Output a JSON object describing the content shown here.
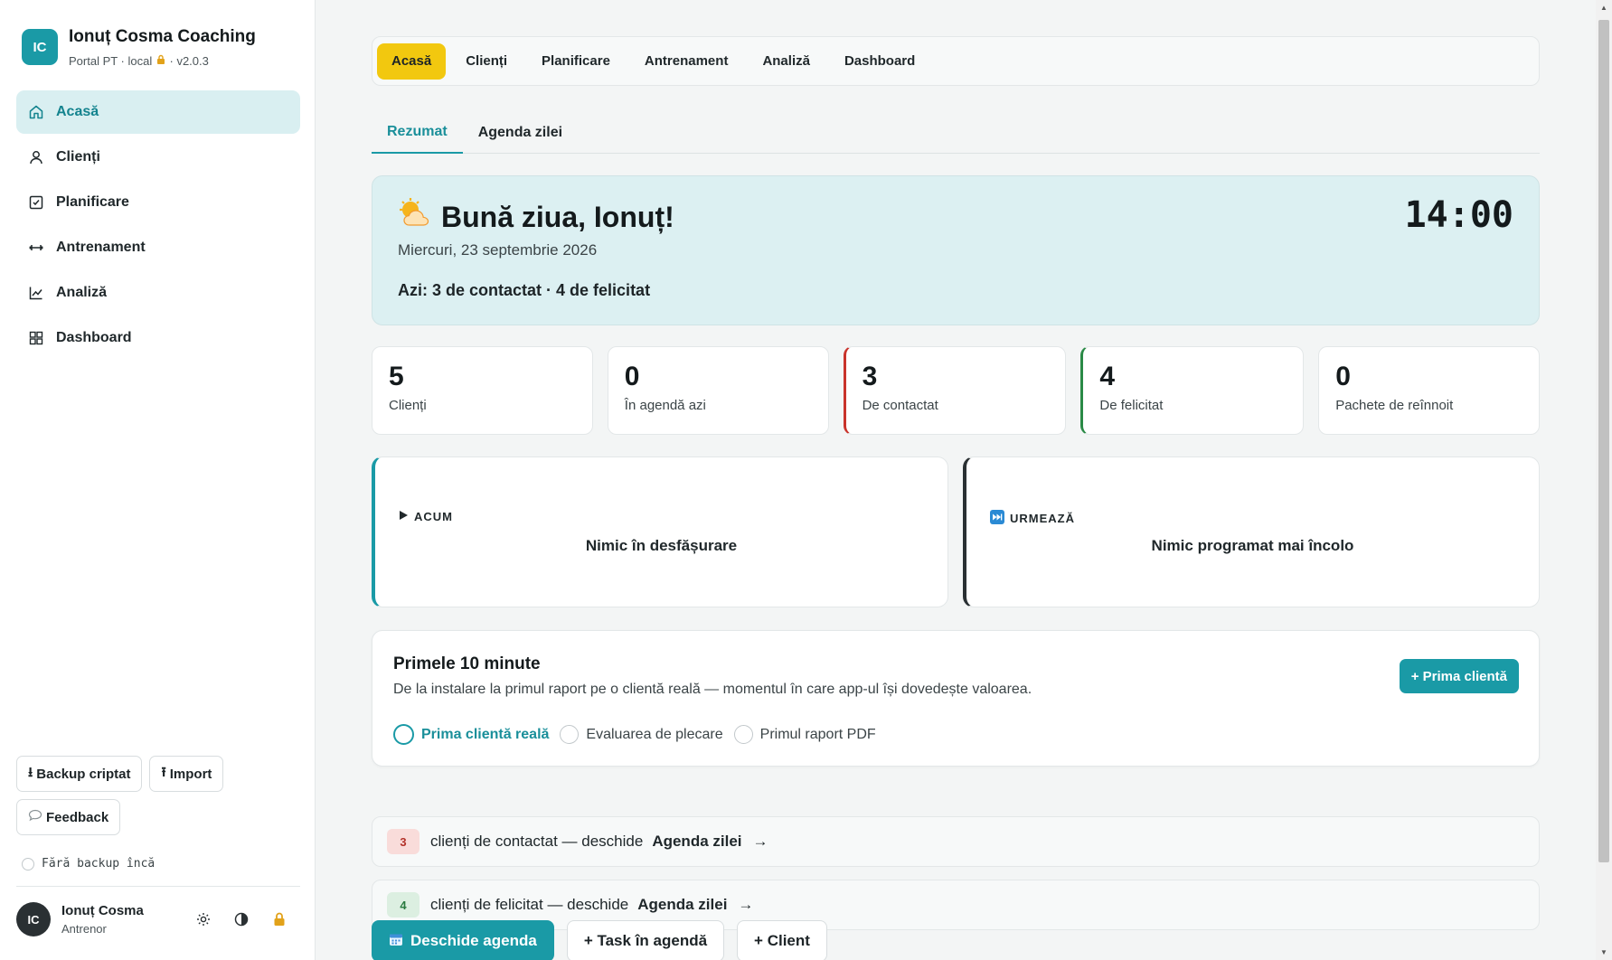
{
  "brand": {
    "initials": "IC",
    "title": "Ionuț Cosma Coaching",
    "subtitle_pre": "Portal PT · local",
    "subtitle_post": "· v2.0.3"
  },
  "sidebar": {
    "items": [
      {
        "label": "Acasă",
        "icon": "home-icon"
      },
      {
        "label": "Clienți",
        "icon": "user-icon"
      },
      {
        "label": "Planificare",
        "icon": "checklist-icon"
      },
      {
        "label": "Antrenament",
        "icon": "dumbbell-icon"
      },
      {
        "label": "Analiză",
        "icon": "chart-line-icon"
      },
      {
        "label": "Dashboard",
        "icon": "grid-icon"
      }
    ],
    "backup_label": "Backup criptat",
    "import_label": "Import",
    "feedback_label": "Feedback",
    "backup_status": "Fără backup încă"
  },
  "user": {
    "initials": "IC",
    "name": "Ionuț Cosma",
    "role": "Antrenor"
  },
  "topnav": [
    "Acasă",
    "Clienți",
    "Planificare",
    "Antrenament",
    "Analiză",
    "Dashboard"
  ],
  "subtabs": [
    "Rezumat",
    "Agenda zilei"
  ],
  "hero": {
    "greeting": "Bună ziua, Ionuț!",
    "date": "Miercuri, 23 septembrie 2026",
    "summary": "Azi: 3 de contactat · 4 de felicitat",
    "time": "14:00"
  },
  "stats": [
    {
      "value": "5",
      "label": "Clienți"
    },
    {
      "value": "0",
      "label": "În agendă azi"
    },
    {
      "value": "3",
      "label": "De contactat"
    },
    {
      "value": "4",
      "label": "De felicitat"
    },
    {
      "value": "0",
      "label": "Pachete de reînnoit"
    }
  ],
  "now_panel": {
    "label": "ACUM",
    "text": "Nimic în desfășurare"
  },
  "next_panel": {
    "label": "URMEAZĂ",
    "text": "Nimic programat mai încolo"
  },
  "onboarding": {
    "title": "Primele 10 minute",
    "description": "De la instalare la primul raport pe o clientă reală — momentul în care app-ul își dovedește valoarea.",
    "button": "+ Prima clientă",
    "steps": [
      "Prima clientă reală",
      "Evaluarea de plecare",
      "Primul raport PDF"
    ]
  },
  "rows": [
    {
      "count": "3",
      "text": "clienți de contactat — deschide",
      "link": "Agenda zilei",
      "arrow": "→"
    },
    {
      "count": "4",
      "text": "clienți de felicitat — deschide",
      "link": "Agenda zilei",
      "arrow": "→"
    }
  ],
  "actions": {
    "open_agenda": "Deschide agenda",
    "task": "+ Task în agendă",
    "client": "+ Client"
  },
  "colors": {
    "accent": "#1a9aa6",
    "active_tab": "#f2c80f",
    "alert": "#c9332b",
    "success": "#2a8a46"
  }
}
